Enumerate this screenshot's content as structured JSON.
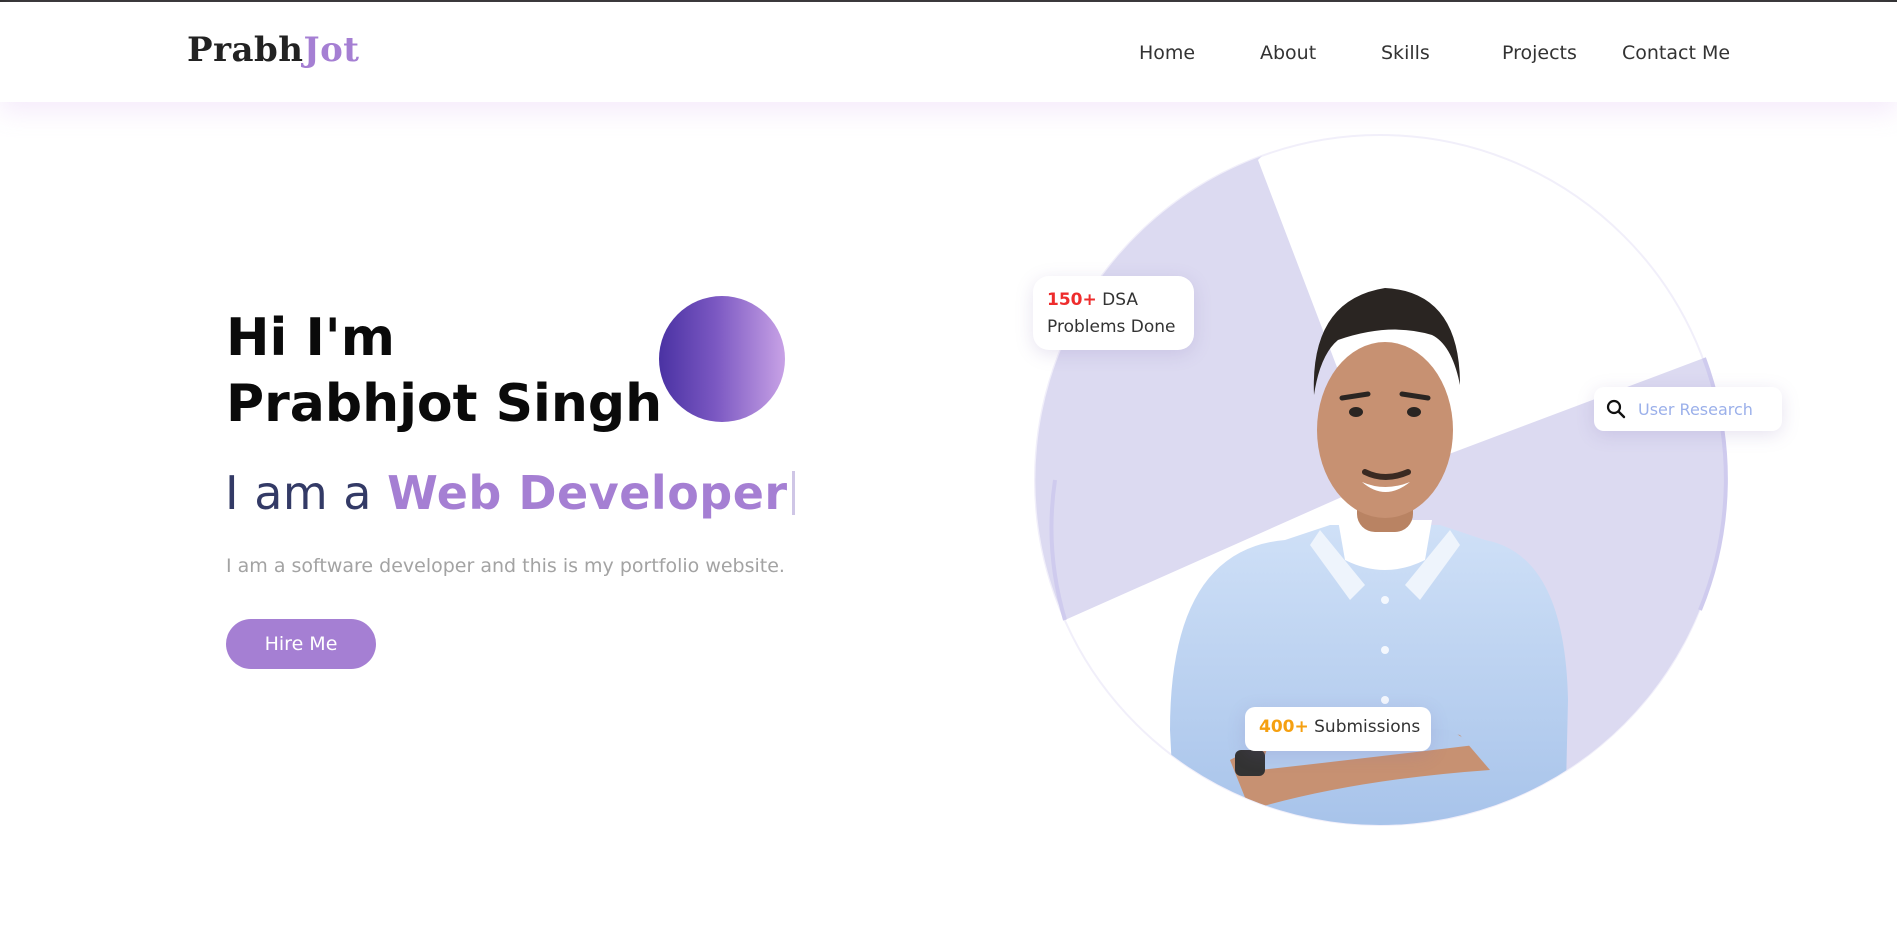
{
  "logo": {
    "part1": "Prabh",
    "part2": "Jot"
  },
  "nav": {
    "items": [
      {
        "label": "Home"
      },
      {
        "label": "About"
      },
      {
        "label": "Skills"
      },
      {
        "label": "Projects"
      },
      {
        "label": "Contact Me"
      }
    ]
  },
  "hero": {
    "greeting_line1": "Hi I'm",
    "greeting_line2": "Prabhjot Singh",
    "role_prefix": "I am a ",
    "role_highlight": "Web Developer",
    "description": "I am a software developer and this is my portfolio website.",
    "cta_label": "Hire Me"
  },
  "badges": {
    "dsa_count": "150+",
    "dsa_text1": "DSA",
    "dsa_text2": "Problems Done",
    "submissions_count": "400+",
    "submissions_text": "Submissions",
    "search_placeholder": "User Research"
  },
  "colors": {
    "accent": "#a57fd3",
    "dsa_highlight": "#ee2c2c",
    "submissions_highlight": "#f5a011",
    "pie_fill": "#dcdaf1"
  }
}
